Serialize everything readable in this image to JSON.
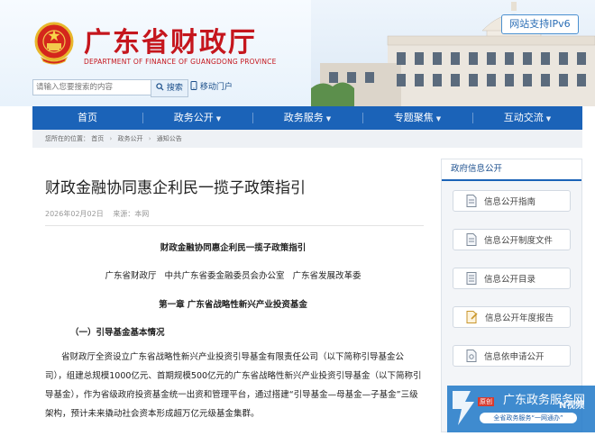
{
  "header": {
    "title": "广东省财政厅",
    "subtitle": "DEPARTMENT OF FINANCE OF GUANGDONG PROVINCE",
    "ipv6": "网站支持IPv6",
    "search": {
      "placeholder": "请输入您要搜索的内容",
      "button": "搜索"
    },
    "mobile_link": "移动门户"
  },
  "nav": {
    "items": [
      {
        "label": "首页",
        "dropdown": false
      },
      {
        "label": "政务公开",
        "dropdown": true
      },
      {
        "label": "政务服务",
        "dropdown": true
      },
      {
        "label": "专题聚焦",
        "dropdown": true
      },
      {
        "label": "互动交流",
        "dropdown": true
      }
    ],
    "dropdown_glyph": "▼"
  },
  "breadcrumb": [
    "您所在的位置：",
    "首页",
    "政务公开",
    "通知公告"
  ],
  "article": {
    "title": "财政金融协同惠企利民一揽子政策指引",
    "date": "2026年02月02日",
    "source": "来源：本网",
    "doc_title": "财政金融协同惠企利民一揽子政策指引",
    "issuers": "广东省财政厅   中共广东省委金融委员会办公室   广东省发展改革委",
    "chapter": "第一章 广东省战略性新兴产业投资基金",
    "section": "（一）引导基金基本情况",
    "paragraph": "省财政厅全资设立广东省战略性新兴产业投资引导基金有限责任公司（以下简称引导基金公司），组建总规模1000亿元、首期规模500亿元的广东省战略性新兴产业投资引导基金（以下简称引导基金），作为省级政府投资基金统一出资和管理平台，通过搭建“引导基金—母基金—子基金”三级架构，预计未来撬动社会资本形成超万亿元级基金集群。"
  },
  "sidebar": {
    "heading": "政府信息公开",
    "items": [
      {
        "label": "信息公开指南",
        "icon": "document-icon"
      },
      {
        "label": "信息公开制度文件",
        "icon": "document-icon"
      },
      {
        "label": "信息公开目录",
        "icon": "list-icon"
      },
      {
        "label": "信息公开年度报告",
        "icon": "report-icon"
      },
      {
        "label": "信息依申请公开",
        "icon": "request-icon"
      }
    ]
  },
  "badge": {
    "title": "广东政务服务网",
    "subtitle": "全省政务服务“一网通办”",
    "tag": "原创",
    "watermark": "N视频"
  },
  "colors": {
    "brand_red": "#c5161d",
    "nav_blue": "#1b63b8",
    "link_blue": "#1a4e8a"
  }
}
